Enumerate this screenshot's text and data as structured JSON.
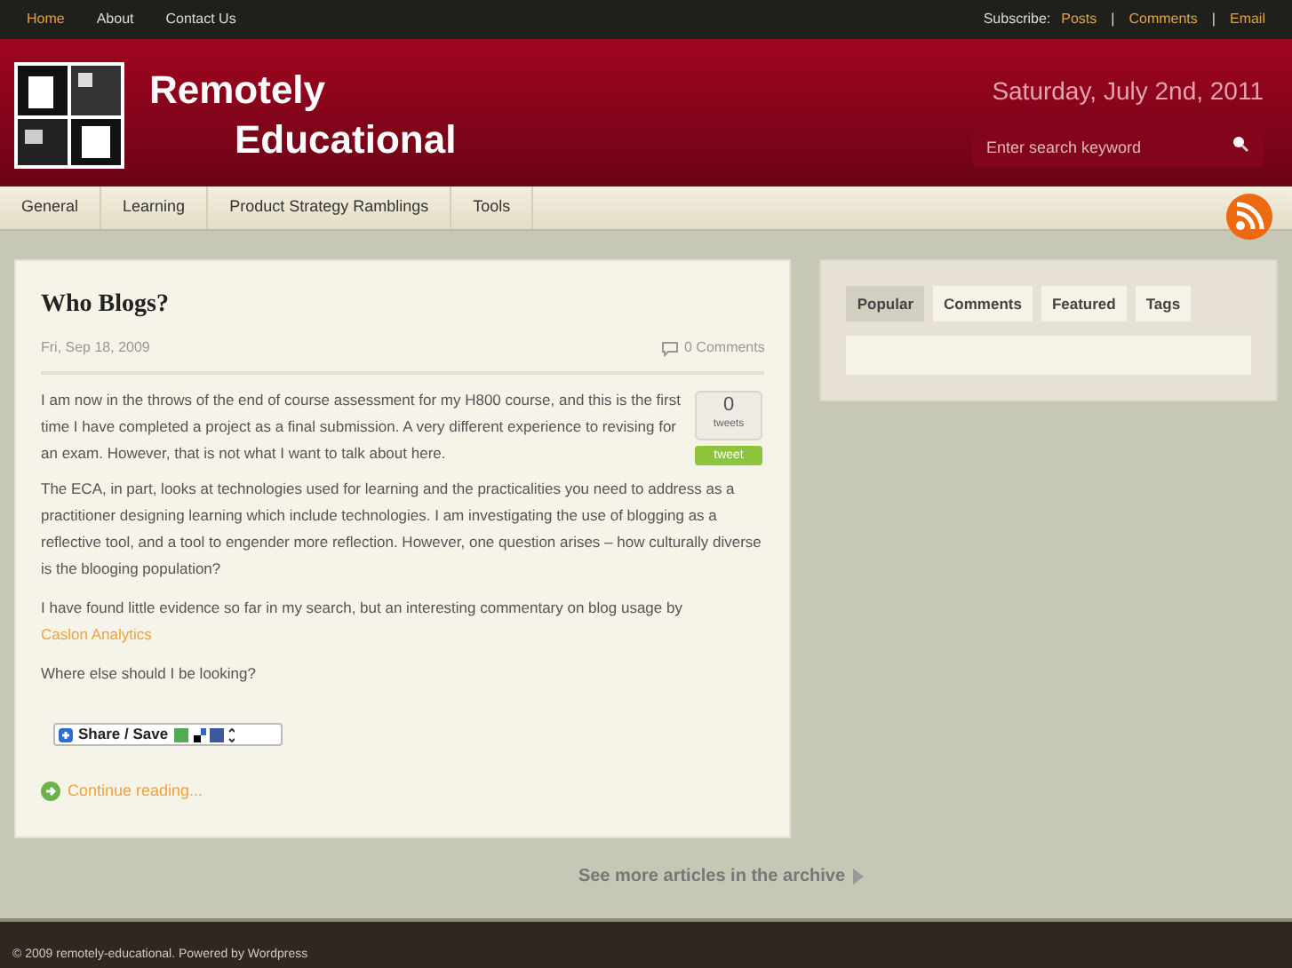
{
  "top_nav": [
    {
      "label": "Home",
      "selected": true
    },
    {
      "label": "About",
      "selected": false
    },
    {
      "label": "Contact Us",
      "selected": false
    }
  ],
  "subscribe": {
    "label": "Subscribe:",
    "links": [
      "Posts",
      "Comments",
      "Email"
    ],
    "separator": "|"
  },
  "site": {
    "title_line_1": "Remotely",
    "title_line_2": "Educational",
    "date": "Saturday, July 2nd, 2011"
  },
  "search": {
    "placeholder": "Enter search keyword"
  },
  "categories": [
    "General",
    "Learning",
    "Product Strategy Ramblings",
    "Tools"
  ],
  "post": {
    "title": "Who Blogs?",
    "date": "Fri, Sep 18, 2009",
    "comments": "0 Comments",
    "tweet_count": "0",
    "tweet_unit": "tweets",
    "tweet_button": "tweet",
    "paragraphs": [
      "I am now in the throws of the end of course assessment for my H800 course, and this is the first time I have completed a project as a final submission.  A very different experience to revising for an exam.  However, that is not what I want to talk about here.",
      "The ECA, in part, looks at technologies used for learning and the practicalities you need to address as a practitioner designing learning which include technologies.  I am investigating the use of blogging as a reflective tool, and a tool to engender more reflection.  However, one question arises – how culturally diverse is the blooging population?",
      "I have found little evidence so far in my search, but an interesting commentary on blog usage by"
    ],
    "link": "Caslon Analytics",
    "question": "Where else should I be looking?",
    "share": "Share / Save",
    "continue": "Continue reading..."
  },
  "sidebar_tabs": [
    {
      "label": "Popular",
      "selected": true
    },
    {
      "label": "Comments",
      "selected": false
    },
    {
      "label": "Featured",
      "selected": false
    },
    {
      "label": "Tags",
      "selected": false
    }
  ],
  "archive_link": "See more articles in the archive",
  "footer": "© 2009 remotely-educational. Powered by Wordpress"
}
